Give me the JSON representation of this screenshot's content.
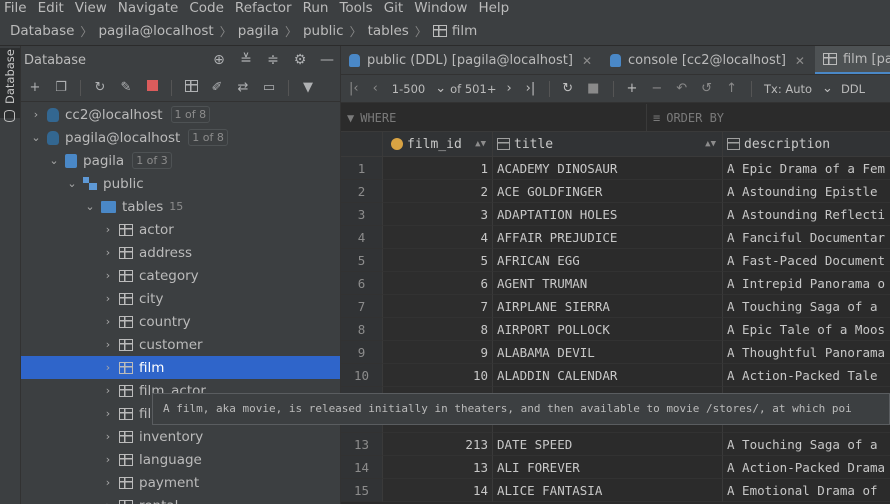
{
  "menubar": {
    "items": [
      "File",
      "Edit",
      "View",
      "Navigate",
      "Code",
      "Refactor",
      "Run",
      "Tools",
      "Git",
      "Window",
      "Help"
    ]
  },
  "breadcrumb": {
    "items": [
      "Database",
      "pagila@localhost",
      "pagila",
      "public",
      "tables",
      "film"
    ]
  },
  "toolstrip": {
    "label": "Database"
  },
  "db_panel": {
    "title": "Database",
    "tree": [
      {
        "label": "cc2@localhost",
        "badge": "1 of 8"
      },
      {
        "label": "pagila@localhost",
        "badge": "1 of 8"
      },
      {
        "label": "pagila",
        "badge": "1 of 3"
      },
      {
        "label": "public"
      },
      {
        "label": "tables",
        "count": "15"
      },
      {
        "label": "actor"
      },
      {
        "label": "address"
      },
      {
        "label": "category"
      },
      {
        "label": "city"
      },
      {
        "label": "country"
      },
      {
        "label": "customer"
      },
      {
        "label": "film"
      },
      {
        "label": "film_actor"
      },
      {
        "label": "film_category"
      },
      {
        "label": "inventory"
      },
      {
        "label": "language"
      },
      {
        "label": "payment"
      },
      {
        "label": "rental"
      }
    ]
  },
  "editor_tabs": [
    {
      "label": "public (DDL) [pagila@localhost]"
    },
    {
      "label": "console [cc2@localhost]"
    },
    {
      "label": "film [pagila@localhost]"
    }
  ],
  "grid_toolbar": {
    "range": "1-500",
    "of": "of 501+",
    "tx": "Tx: Auto",
    "ddl": "DDL"
  },
  "filter": {
    "where": "WHERE",
    "order_by": "ORDER BY"
  },
  "grid": {
    "columns": [
      "film_id",
      "title",
      "description"
    ],
    "rows": [
      {
        "num": "1",
        "id": "1",
        "title": "ACADEMY DINOSAUR",
        "desc": "A Epic Drama of a Fem"
      },
      {
        "num": "2",
        "id": "2",
        "title": "ACE GOLDFINGER",
        "desc": "A Astounding Epistle"
      },
      {
        "num": "3",
        "id": "3",
        "title": "ADAPTATION HOLES",
        "desc": "A Astounding Reflecti"
      },
      {
        "num": "4",
        "id": "4",
        "title": "AFFAIR PREJUDICE",
        "desc": "A Fanciful Documentar"
      },
      {
        "num": "5",
        "id": "5",
        "title": "AFRICAN EGG",
        "desc": "A Fast-Paced Document"
      },
      {
        "num": "6",
        "id": "6",
        "title": "AGENT TRUMAN",
        "desc": "A Intrepid Panorama o"
      },
      {
        "num": "7",
        "id": "7",
        "title": "AIRPLANE SIERRA",
        "desc": "A Touching Saga of a"
      },
      {
        "num": "8",
        "id": "8",
        "title": "AIRPORT POLLOCK",
        "desc": "A Epic Tale of a Moos"
      },
      {
        "num": "9",
        "id": "9",
        "title": "ALABAMA DEVIL",
        "desc": "A Thoughtful Panorama"
      },
      {
        "num": "10",
        "id": "10",
        "title": "ALADDIN CALENDAR",
        "desc": "A Action-Packed Tale"
      },
      {
        "num": "",
        "id": "",
        "title": "",
        "desc": ""
      },
      {
        "num": "",
        "id": "",
        "title": "",
        "desc": ""
      },
      {
        "num": "13",
        "id": "213",
        "title": "DATE SPEED",
        "desc": "A Touching Saga of a"
      },
      {
        "num": "14",
        "id": "13",
        "title": "ALI FOREVER",
        "desc": "A Action-Packed Drama"
      },
      {
        "num": "15",
        "id": "14",
        "title": "ALICE FANTASIA",
        "desc": "A Emotional Drama of"
      }
    ]
  },
  "tooltip": {
    "text": "A film, aka movie, is released initially in theaters, and then available to movie /stores/, at which poi"
  },
  "colors": {
    "selection": "#2f65ca",
    "background": "#2b2b2b",
    "panel": "#3c3f41",
    "accent": "#4a88c7"
  }
}
